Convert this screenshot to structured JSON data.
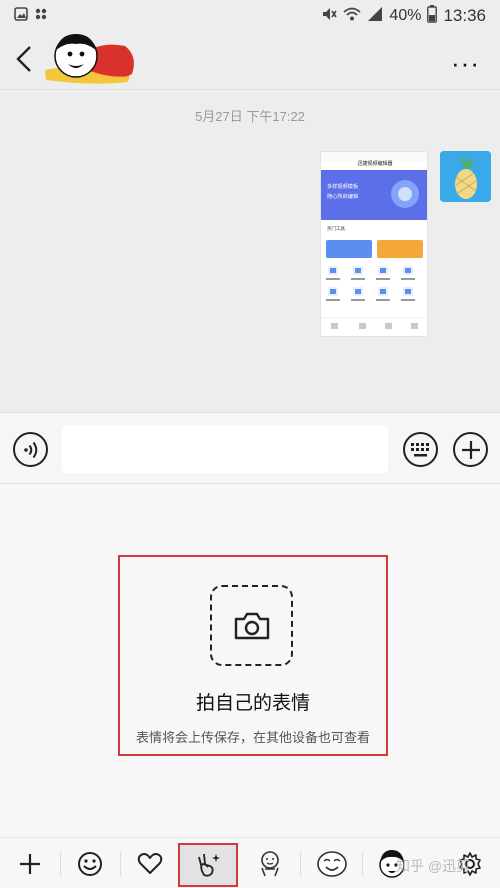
{
  "status_bar": {
    "battery_percent": "40%",
    "time": "13:36",
    "icons": [
      "photo-icon",
      "settings-dots-icon",
      "mute-icon",
      "wifi-icon",
      "signal-icon",
      "battery-icon"
    ]
  },
  "header": {
    "back_icon": "chevron-left-icon",
    "more_label": "···"
  },
  "chat": {
    "timestamp": "5月27日 下午17:22",
    "screenshot": {
      "app_title": "迅捷视频编辑器",
      "banner_line1": "多样视频模板",
      "banner_line2": "随心所欲编辑",
      "section_title": "热门工具"
    }
  },
  "input_bar": {
    "text_value": "",
    "voice_icon": "voice-icon",
    "keyboard_icon": "keyboard-icon",
    "plus_icon": "plus-icon"
  },
  "sticker_panel": {
    "create_title": "拍自己的表情",
    "create_subtitle": "表情将会上传保存，在其他设备也可查看",
    "camera_icon": "camera-icon"
  },
  "tabs": {
    "items": [
      "add-icon",
      "emoji-icon",
      "heart-icon",
      "selfie-sticker-icon",
      "sticker-pack-1",
      "sticker-pack-2",
      "sticker-pack-3",
      "settings-gear-icon"
    ],
    "selected": "selfie-sticker-icon"
  },
  "watermark": "知乎 @迅剪",
  "colors": {
    "highlight_border": "#d33a3a",
    "background": "#ededed"
  }
}
